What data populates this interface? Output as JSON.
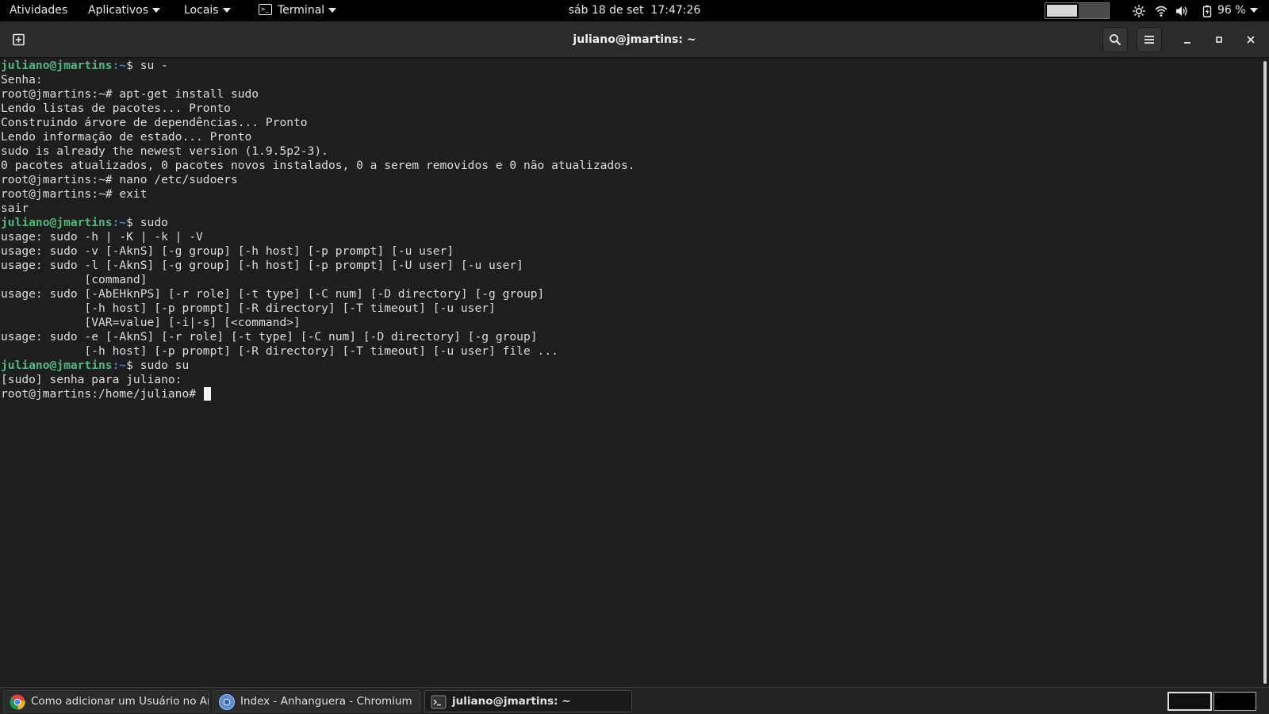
{
  "topbar": {
    "activities": "Atividades",
    "applications": "Aplicativos",
    "places": "Locais",
    "app_menu": "Terminal",
    "clock": "sáb 18 de set  17:47:26",
    "battery": "96 %"
  },
  "window": {
    "title": "juliano@jmartins: ~"
  },
  "terminal": {
    "lines": [
      {
        "user": "juliano@jmartins",
        "path": ":~",
        "text": "$ su -"
      },
      {
        "text": "Senha:"
      },
      {
        "text": "root@jmartins:~# apt-get install sudo"
      },
      {
        "text": "Lendo listas de pacotes... Pronto"
      },
      {
        "text": "Construindo árvore de dependências... Pronto"
      },
      {
        "text": "Lendo informação de estado... Pronto"
      },
      {
        "text": "sudo is already the newest version (1.9.5p2-3)."
      },
      {
        "text": "0 pacotes atualizados, 0 pacotes novos instalados, 0 a serem removidos e 0 não atualizados."
      },
      {
        "text": "root@jmartins:~# nano /etc/sudoers"
      },
      {
        "text": "root@jmartins:~# exit"
      },
      {
        "text": "sair"
      },
      {
        "user": "juliano@jmartins",
        "path": ":~",
        "text": "$ sudo"
      },
      {
        "text": "usage: sudo -h | -K | -k | -V"
      },
      {
        "text": "usage: sudo -v [-AknS] [-g group] [-h host] [-p prompt] [-u user]"
      },
      {
        "text": "usage: sudo -l [-AknS] [-g group] [-h host] [-p prompt] [-U user] [-u user]"
      },
      {
        "text": "            [command]"
      },
      {
        "text": "usage: sudo [-AbEHknPS] [-r role] [-t type] [-C num] [-D directory] [-g group]"
      },
      {
        "text": "            [-h host] [-p prompt] [-R directory] [-T timeout] [-u user]"
      },
      {
        "text": "            [VAR=value] [-i|-s] [<command>]"
      },
      {
        "text": "usage: sudo -e [-AknS] [-r role] [-t type] [-C num] [-D directory] [-g group]"
      },
      {
        "text": "            [-h host] [-p prompt] [-R directory] [-T timeout] [-u user] file ..."
      },
      {
        "user": "juliano@jmartins",
        "path": ":~",
        "text": "$ sudo su"
      },
      {
        "text": "[sudo] senha para juliano:"
      },
      {
        "text": "root@jmartins:/home/juliano# ",
        "cursor": true
      }
    ]
  },
  "taskbar": {
    "tasks": [
      {
        "label": "Como adicionar um Usuário no Ar...",
        "icon": "chrome-icon"
      },
      {
        "label": "Index - Anhanguera - Chromium",
        "icon": "chromium-icon"
      },
      {
        "label": "juliano@jmartins: ~",
        "icon": "terminal-icon"
      }
    ]
  },
  "colors": {
    "prompt_user": "#4fb87e",
    "prompt_path": "#3d82d1",
    "terminal_bg": "#1e1e1e",
    "terminal_fg": "#dcdcdc"
  }
}
